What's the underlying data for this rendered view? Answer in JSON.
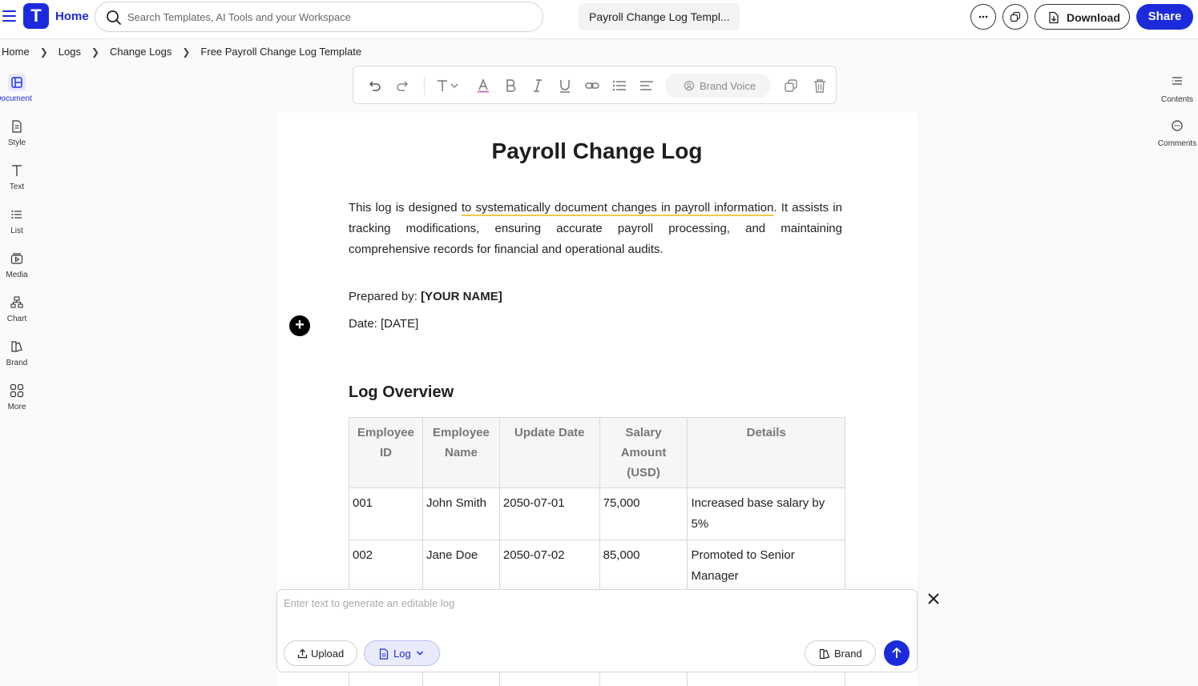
{
  "topbar": {
    "home_label": "Home",
    "logo_letter": "T",
    "search_placeholder": "Search Templates, AI Tools and your Workspace",
    "document_title": "Payroll Change Log Templ...",
    "download_label": "Download",
    "share_label": "Share"
  },
  "breadcrumb": [
    "Home",
    "Logs",
    "Change Logs",
    "Free Payroll Change Log Template"
  ],
  "left_nav": [
    {
      "label": "Document",
      "icon": "document-layout-icon",
      "active": true
    },
    {
      "label": "Style",
      "icon": "style-icon"
    },
    {
      "label": "Text",
      "icon": "text-icon"
    },
    {
      "label": "List",
      "icon": "list-icon"
    },
    {
      "label": "Media",
      "icon": "media-icon"
    },
    {
      "label": "Chart",
      "icon": "chart-icon"
    },
    {
      "label": "Brand",
      "icon": "brand-icon"
    },
    {
      "label": "More",
      "icon": "grid-icon"
    }
  ],
  "right_nav": [
    {
      "label": "Contents",
      "icon": "contents-icon"
    },
    {
      "label": "Comments",
      "icon": "comments-icon"
    }
  ],
  "toolbar": {
    "brand_voice_label": "Brand Voice"
  },
  "document": {
    "title": "Payroll Change Log",
    "intro_before": "This log is designed ",
    "intro_highlight": "to systematically document changes in payroll information",
    "intro_after": ". It assists in tracking modifications, ensuring accurate payroll processing, and maintaining comprehensive records for financial and operational audits.",
    "prepared_label": "Prepared by: ",
    "prepared_value": "[YOUR NAME]",
    "date_line": "Date: [DATE]",
    "section_heading": "Log Overview",
    "table": {
      "headers": [
        "Employee ID",
        "Employee Name",
        "Update Date",
        "Salary Amount (USD)",
        "Details"
      ],
      "rows": [
        [
          "001",
          "John Smith",
          "2050-07-01",
          "75,000",
          "Increased base salary by 5%"
        ],
        [
          "002",
          "Jane Doe",
          "2050-07-02",
          "85,000",
          "Promoted to Senior Manager"
        ]
      ]
    }
  },
  "prompt": {
    "placeholder": "Enter text to generate an editable log",
    "upload_label": "Upload",
    "log_label": "Log",
    "brand_label": "Brand"
  },
  "colors": {
    "accent": "#1b2bdc",
    "highlight_underline": "#f0c94a",
    "table_header_bg": "#f5f6f8"
  }
}
